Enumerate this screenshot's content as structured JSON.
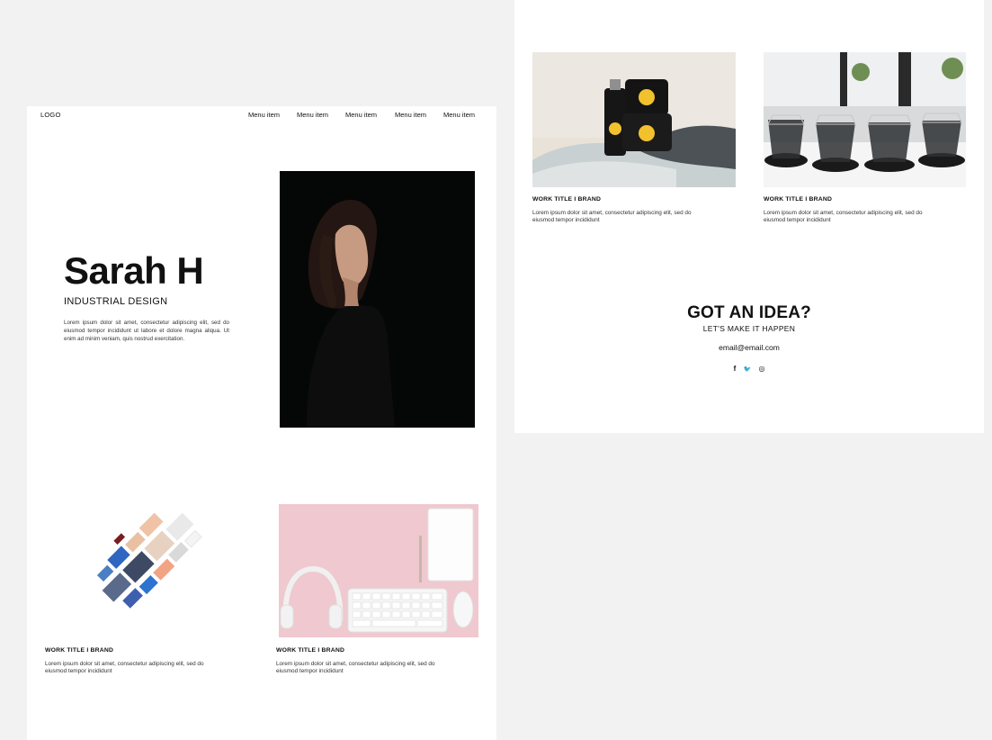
{
  "nav": {
    "logo": "LOGO",
    "items": [
      "Menu item",
      "Menu item",
      "Menu item",
      "Menu item",
      "Menu item"
    ]
  },
  "hero": {
    "name": "Sarah H",
    "role": "INDUSTRIAL DESIGN",
    "bio": "Lorem ipsum dolor sit amet, consectetur adipiscing elit, sed do eiusmod tempor incididunt ut labore et dolore magna aliqua. Ut enim ad minim veniam, quis nostrud exercitation."
  },
  "works": [
    {
      "title": "WORK TITLE I BRAND",
      "desc": "Lorem ipsum dolor sit amet, consectetur adipiscing elit, sed do eiusmod tempor incididunt"
    },
    {
      "title": "WORK TITLE I BRAND",
      "desc": "Lorem ipsum dolor sit amet, consectetur adipiscing elit, sed do eiusmod tempor incididunt"
    },
    {
      "title": "WORK TITLE I BRAND",
      "desc": "Lorem ipsum dolor sit amet, consectetur adipiscing elit, sed do eiusmod tempor incididunt"
    },
    {
      "title": "WORK TITLE I BRAND",
      "desc": "Lorem ipsum dolor sit amet, consectetur adipiscing elit, sed do eiusmod tempor incididunt"
    }
  ],
  "cta": {
    "title": "GOT AN IDEA?",
    "subtitle": "LET'S MAKE IT HAPPEN",
    "email": "email@email.com"
  },
  "socials": {
    "facebook": "f",
    "twitter": "🐦",
    "instagram": "◎"
  },
  "colors": {
    "background": "#f2f2f2",
    "page": "#ffffff",
    "text": "#111111"
  }
}
